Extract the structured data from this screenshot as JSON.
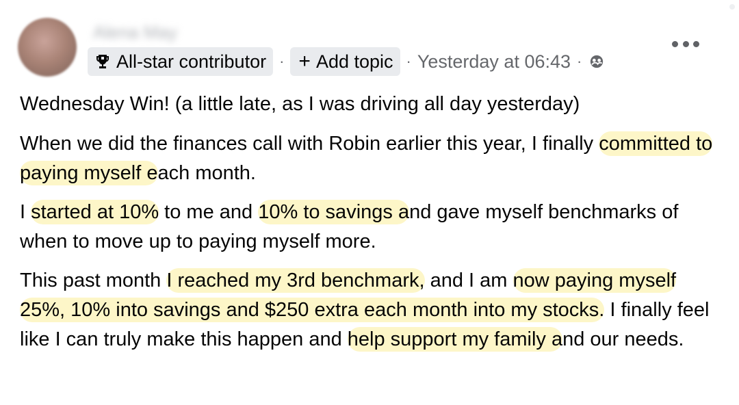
{
  "post": {
    "author_name": "Alena May",
    "badge_label": "All-star contributor",
    "add_topic_label": "Add topic",
    "add_topic_plus": "+",
    "separator": "·",
    "timestamp": "Yesterday at 06:43",
    "icons": {
      "badge": "trophy-icon",
      "privacy": "group-privacy-icon",
      "menu": "more-options-icon"
    },
    "colors": {
      "highlight": "#fdf6c8",
      "chip_bg": "#e9ebee",
      "meta_text": "#65676b"
    },
    "body": {
      "p1": "Wednesday Win! (a little late, as I was driving all day yesterday)",
      "p2_a": "When we did the finances call with Robin earlier this year,  I finally ",
      "p2_hl1": "committed to paying myself e",
      "p2_b": "ach month.",
      "p3_a": "I ",
      "p3_hl1": "started at 10%",
      "p3_b": " to me and ",
      "p3_hl2": "10% to savings a",
      "p3_c": "nd gave myself benchmarks of when to move up to paying myself more.",
      "p4_a": "This past month ",
      "p4_hl1": "I reached my 3rd benchmark,",
      "p4_b": " and I am ",
      "p4_hl2": "now paying myself 25%, 10% into savings and $250 extra each month into my stocks.",
      "p4_c": " I finally feel like I can truly make this happen and ",
      "p4_hl3": "help support my family a",
      "p4_d": "nd our needs."
    }
  }
}
